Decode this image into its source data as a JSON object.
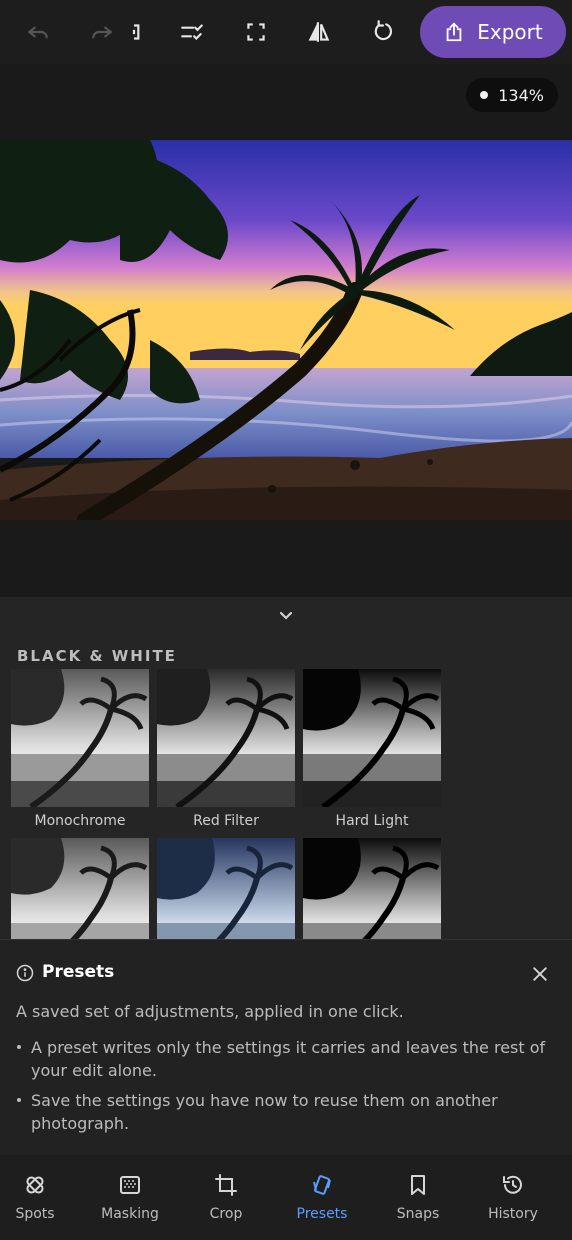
{
  "toolbar": {
    "export_label": "Export",
    "accent_color": "#6f4bb5"
  },
  "canvas": {
    "zoom": "134%"
  },
  "presets_panel": {
    "section_title": "BLACK & WHITE",
    "presets": [
      {
        "label": "Monochrome"
      },
      {
        "label": "Red Filter"
      },
      {
        "label": "Hard Light"
      },
      {
        "label": ""
      },
      {
        "label": ""
      },
      {
        "label": ""
      }
    ]
  },
  "info_sheet": {
    "title": "Presets",
    "description": "A saved set of adjustments, applied in one click.",
    "bullets": [
      "A preset writes only the settings it carries and leaves the rest of your edit alone.",
      "Save the settings you have now to reuse them on another photograph."
    ]
  },
  "bottom_nav": {
    "items": [
      {
        "label": "Spots",
        "icon": "bandage-icon"
      },
      {
        "label": "Masking",
        "icon": "mask-icon"
      },
      {
        "label": "Crop",
        "icon": "crop-icon"
      },
      {
        "label": "Presets",
        "icon": "presets-icon",
        "active": true
      },
      {
        "label": "Snaps",
        "icon": "bookmark-icon"
      },
      {
        "label": "History",
        "icon": "history-icon"
      }
    ],
    "active_color": "#5b9dff"
  }
}
